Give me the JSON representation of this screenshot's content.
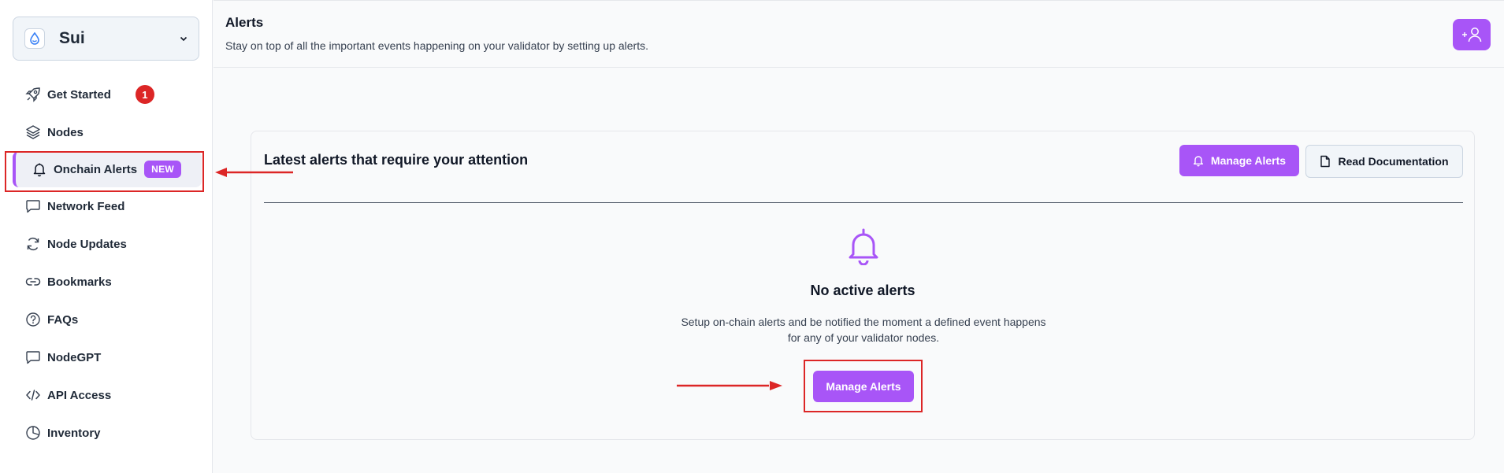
{
  "sidebar": {
    "network": {
      "name": "Sui"
    },
    "items": [
      {
        "label": "Get Started",
        "icon": "rocket-icon",
        "badge": "1"
      },
      {
        "label": "Nodes",
        "icon": "layers-icon"
      },
      {
        "label": "Onchain Alerts",
        "icon": "bell-icon",
        "badge": "NEW",
        "active": true
      },
      {
        "label": "Network Feed",
        "icon": "message-square-icon"
      },
      {
        "label": "Node Updates",
        "icon": "refresh-icon"
      },
      {
        "label": "Bookmarks",
        "icon": "link-icon"
      },
      {
        "label": "FAQs",
        "icon": "help-circle-icon"
      },
      {
        "label": "NodeGPT",
        "icon": "message-square-icon"
      },
      {
        "label": "API Access",
        "icon": "code-icon"
      },
      {
        "label": "Inventory",
        "icon": "pie-chart-icon"
      }
    ]
  },
  "header": {
    "title": "Alerts",
    "subtitle": "Stay on top of all the important events happening on your validator by setting up alerts."
  },
  "card": {
    "title": "Latest alerts that require your attention",
    "manage_label": "Manage Alerts",
    "docs_label": "Read Documentation",
    "empty_title": "No active alerts",
    "empty_desc_line1": "Setup on-chain alerts and be notified the moment a defined event happens",
    "empty_desc_line2": "for any of your validator nodes.",
    "empty_cta": "Manage Alerts"
  },
  "colors": {
    "accent": "#a855f7",
    "badge_red": "#dc2626",
    "annotation_red": "#dc2626"
  }
}
